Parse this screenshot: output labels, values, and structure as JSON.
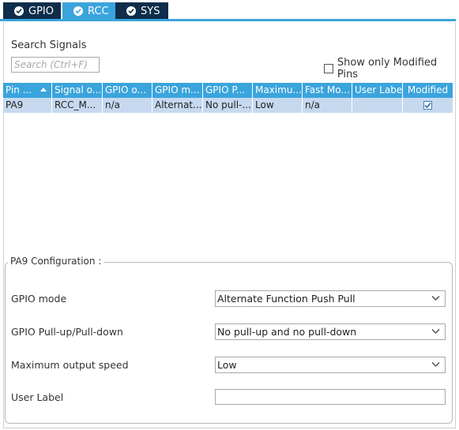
{
  "tabs": [
    {
      "label": "GPIO",
      "active": false
    },
    {
      "label": "RCC",
      "active": true
    },
    {
      "label": "SYS",
      "active": false
    }
  ],
  "search": {
    "label": "Search Signals",
    "placeholder": "Search (Ctrl+F)",
    "value": ""
  },
  "show_modified": {
    "label": "Show only Modified Pins",
    "checked": false
  },
  "table": {
    "headers": [
      "Pin ...",
      "Signal o...",
      "GPIO o...",
      "GPIO m...",
      "GPIO P...",
      "Maximu...",
      "Fast Mo...",
      "User Label",
      "Modified"
    ],
    "rows": [
      {
        "pin": "PA9",
        "signal": "RCC_M...",
        "gpio_output": "n/a",
        "gpio_mode": "Alternat...",
        "gpio_pull": "No pull-...",
        "max_speed": "Low",
        "fast_mode": "n/a",
        "user_label": "",
        "modified": true
      }
    ]
  },
  "config": {
    "title": "PA9 Configuration :",
    "gpio_mode": {
      "label": "GPIO mode",
      "value": "Alternate Function Push Pull"
    },
    "pull": {
      "label": "GPIO Pull-up/Pull-down",
      "value": "No pull-up and no pull-down"
    },
    "speed": {
      "label": "Maximum output speed",
      "value": "Low"
    },
    "user_label": {
      "label": "User Label",
      "value": ""
    }
  },
  "colors": {
    "tab_active": "#3aa4dc",
    "tab_inactive": "#0d2d4a",
    "header_bg": "#3aa4dc",
    "row_selected": "#c6d9ef"
  }
}
